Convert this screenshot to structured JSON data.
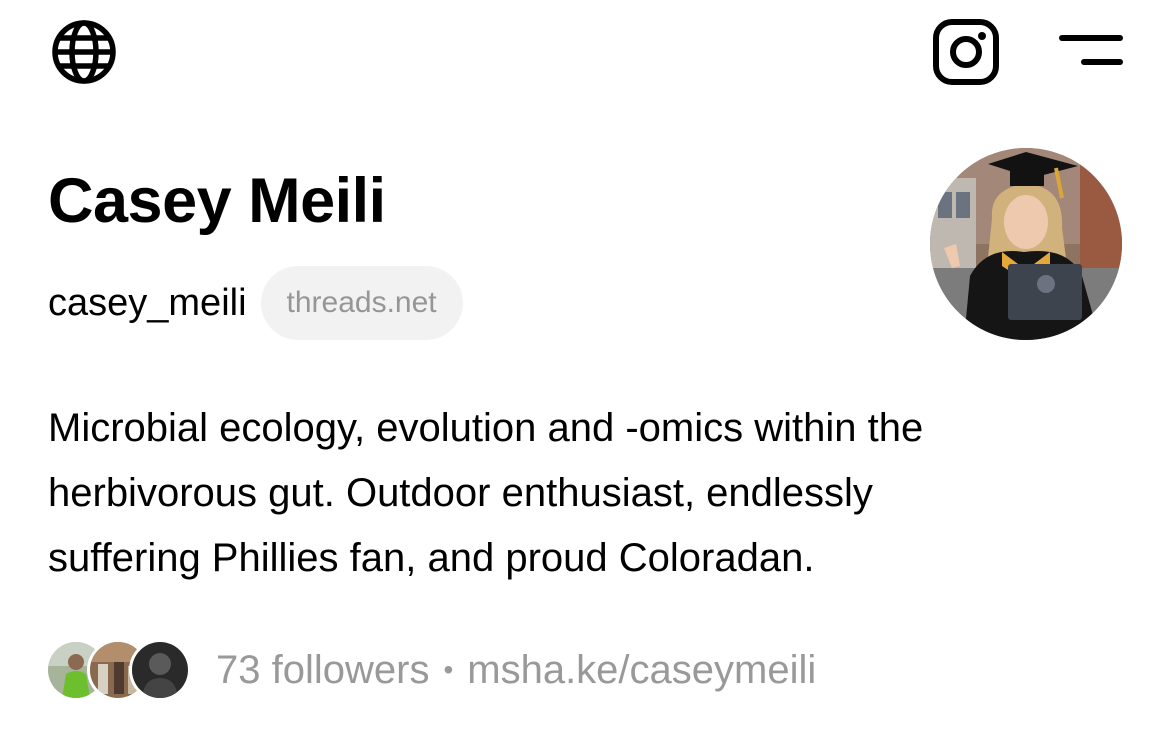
{
  "header": {
    "globe_icon": "globe-icon",
    "instagram_icon": "instagram-icon",
    "menu_icon": "menu-icon"
  },
  "profile": {
    "name": "Casey Meili",
    "username": "casey_meili",
    "domain_badge": "threads.net",
    "bio_lines": [
      "Microbial ecology, evolution and -omics within the",
      "herbivorous gut. Outdoor enthusiast, endlessly",
      "suffering Phillies fan, and proud Coloradan."
    ],
    "followers": "73 followers",
    "separator": "•",
    "link": "msha.ke/caseymeili"
  },
  "colors": {
    "text": "#000000",
    "muted": "#999999",
    "pill_bg": "#f2f2f2"
  }
}
